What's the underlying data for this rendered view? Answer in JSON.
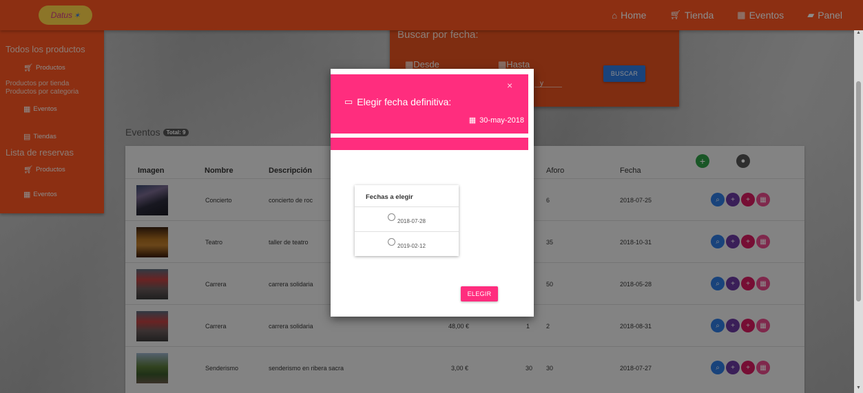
{
  "nav": {
    "logo_text": "Datus",
    "items": [
      {
        "label": "Home",
        "icon": "home-icon"
      },
      {
        "label": "Tienda",
        "icon": "cart-icon"
      },
      {
        "label": "Eventos",
        "icon": "calendar-icon"
      },
      {
        "label": "Panel",
        "icon": "briefcase-icon"
      }
    ]
  },
  "sidebar": {
    "heading_all": "Todos los productos",
    "productos": "Productos",
    "by_store": "Productos por tienda",
    "by_category": "Productos por categoria",
    "eventos": "Eventos",
    "tiendas": "Tiendas",
    "heading_reservas": "Lista de reservas",
    "res_productos": "Productos",
    "res_eventos": "Eventos"
  },
  "search": {
    "title": "Buscar por fecha:",
    "desde": "Desde",
    "hasta": "Hasta",
    "button": "BUSCAR",
    "partial": "y"
  },
  "events": {
    "title": "Eventos",
    "total_badge": "Total: 9",
    "headers": {
      "imagen": "Imagen",
      "nombre": "Nombre",
      "descripcion": "Descripción",
      "aforo": "Aforo",
      "fecha": "Fecha"
    },
    "rows": [
      {
        "nombre": "Concierto",
        "descripcion": "concierto de roc",
        "precio": "",
        "plazas": "",
        "aforo": "6",
        "fecha": "2018-07-25"
      },
      {
        "nombre": "Teatro",
        "descripcion": "taller de teatro",
        "precio": "",
        "plazas": "",
        "aforo": "35",
        "fecha": "2018-10-31"
      },
      {
        "nombre": "Carrera",
        "descripcion": "carrera solidaria",
        "precio": "",
        "plazas": "",
        "aforo": "50",
        "fecha": "2018-05-28"
      },
      {
        "nombre": "Carrera",
        "descripcion": "carrera solidaria",
        "precio": "48,00 €",
        "plazas": "1",
        "aforo": "2",
        "fecha": "2018-08-31"
      },
      {
        "nombre": "Senderismo",
        "descripcion": "senderismo en ribera sacra",
        "precio": "3,00 €",
        "plazas": "30",
        "aforo": "30",
        "fecha": "2018-07-27"
      }
    ]
  },
  "modal": {
    "title": "Elegir fecha definitiva:",
    "close": "×",
    "current_date": "30-may-2018",
    "choices_title": "Fechas a elegir",
    "choices": [
      "2018-07-28",
      "2019-02-12"
    ],
    "button": "ELEGIR"
  },
  "colors": {
    "primary": "#ff5722",
    "accent": "#ff2d7e",
    "search_button": "#2f7be0"
  }
}
